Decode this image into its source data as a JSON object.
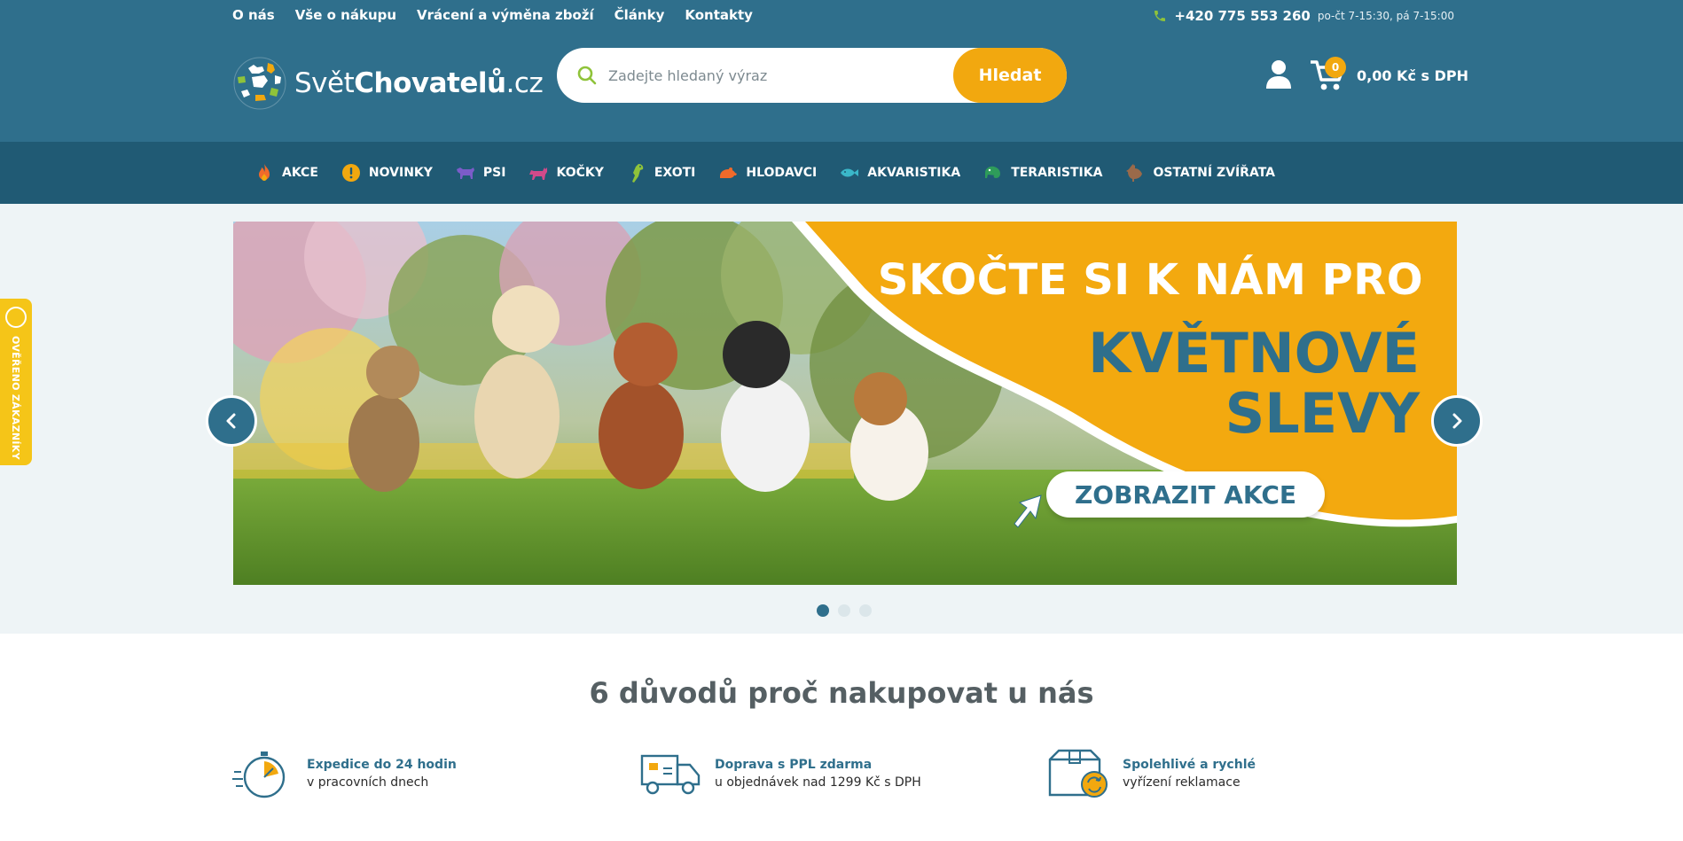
{
  "top_links": [
    "O nás",
    "Vše o nákupu",
    "Vrácení a výměna zboží",
    "Články",
    "Kontakty"
  ],
  "contact": {
    "phone": "+420 775 553 260",
    "hours": "po-čt 7-15:30, pá 7-15:00"
  },
  "logo": {
    "part1": "Svět",
    "part2": "Chovatelů",
    "part3": ".cz"
  },
  "search": {
    "placeholder": "Zadejte hledaný výraz",
    "button": "Hledat"
  },
  "cart": {
    "count": "0",
    "total": "0,00 Kč s DPH"
  },
  "categories": [
    {
      "label": "AKCE",
      "icon": "fire-icon",
      "color": "#f06a2a"
    },
    {
      "label": "NOVINKY",
      "icon": "exclamation-icon",
      "color": "#f2a80f"
    },
    {
      "label": "PSI",
      "icon": "dog-icon",
      "color": "#7b5cc9"
    },
    {
      "label": "KOČKY",
      "icon": "cat-icon",
      "color": "#d24a8a"
    },
    {
      "label": "EXOTI",
      "icon": "parrot-icon",
      "color": "#8fc33a"
    },
    {
      "label": "HLODAVCI",
      "icon": "rodent-icon",
      "color": "#f06a2a"
    },
    {
      "label": "AKVARISTIKA",
      "icon": "fish-icon",
      "color": "#3ab7c9"
    },
    {
      "label": "TERARISTIKA",
      "icon": "chameleon-icon",
      "color": "#2e9c5a"
    },
    {
      "label": "OSTATNÍ ZVÍŘATA",
      "icon": "hen-icon",
      "color": "#9a6a4a"
    }
  ],
  "banner": {
    "line1": "SKOČTE SI K NÁM PRO",
    "line2": "KVĚTNOVÉ",
    "line3": "SLEVY",
    "cta": "ZOBRAZIT AKCE"
  },
  "side_badge": "OVĚŘENO ZÁKAZNÍKY",
  "reasons_title": "6 důvodů proč nakupovat u nás",
  "reasons": [
    {
      "title": "Expedice do 24 hodin",
      "sub": "v pracovních dnech",
      "icon": "stopwatch-icon"
    },
    {
      "title": "Doprava s PPL zdarma",
      "sub": "u objednávek nad 1299 Kč s DPH",
      "icon": "delivery-truck-icon"
    },
    {
      "title": "Spolehlivé a rychlé",
      "sub": "vyřízení reklamace",
      "icon": "return-box-icon"
    }
  ],
  "colors": {
    "header": "#2f6f8c",
    "nav": "#205a74",
    "accent": "#f2a80f"
  }
}
